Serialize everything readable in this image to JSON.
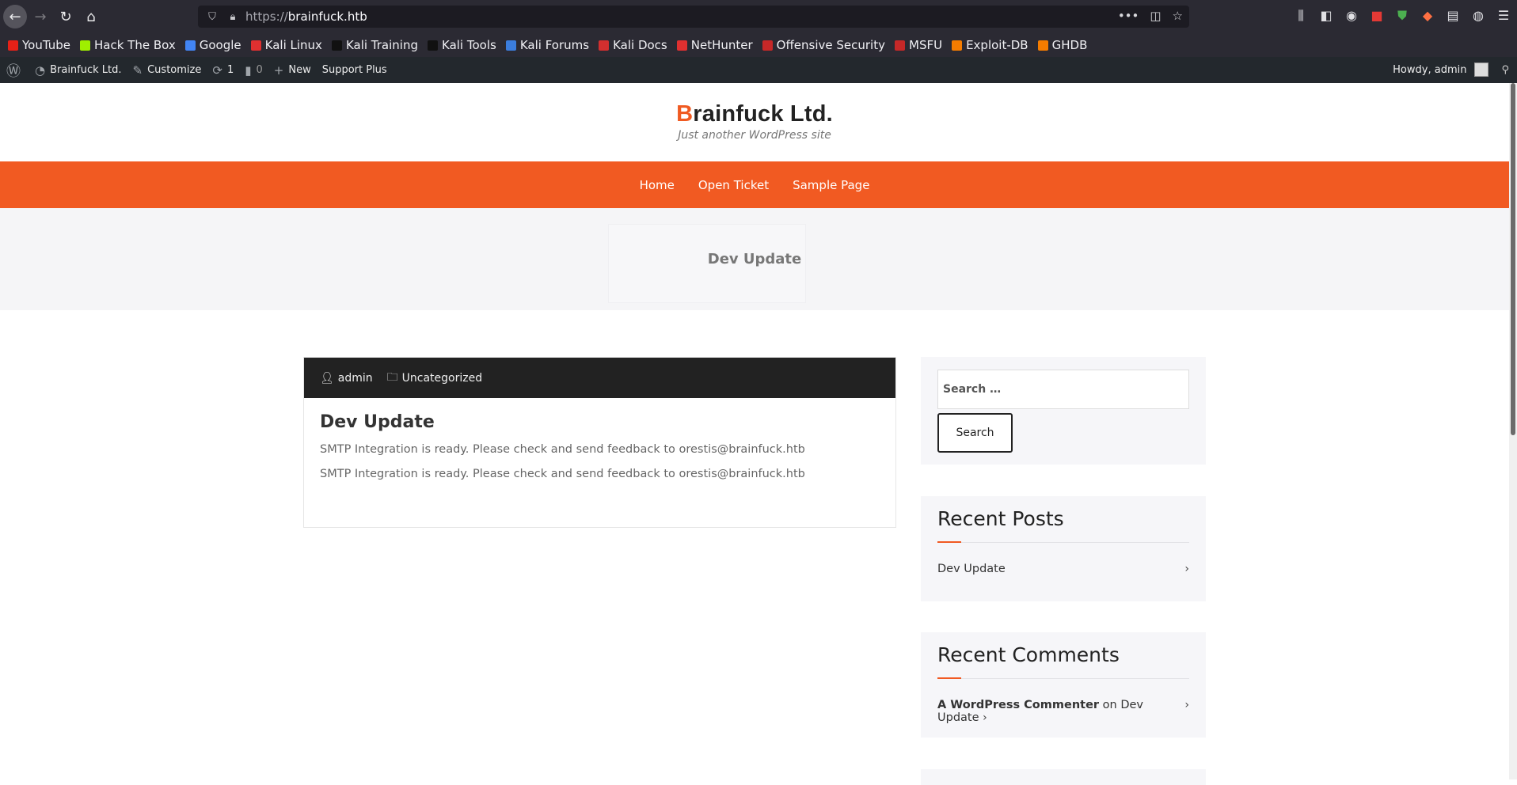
{
  "browser": {
    "url_proto": "https://",
    "url_host": "brainfuck.htb",
    "bookmarks": [
      {
        "label": "YouTube",
        "color": "#e62117"
      },
      {
        "label": "Hack The Box",
        "color": "#9fef00"
      },
      {
        "label": "Google",
        "color": "#4285f4"
      },
      {
        "label": "Kali Linux",
        "color": "#e03030"
      },
      {
        "label": "Kali Training",
        "color": "#111111"
      },
      {
        "label": "Kali Tools",
        "color": "#111111"
      },
      {
        "label": "Kali Forums",
        "color": "#3b7ddd"
      },
      {
        "label": "Kali Docs",
        "color": "#d32f2f"
      },
      {
        "label": "NetHunter",
        "color": "#e03030"
      },
      {
        "label": "Offensive Security",
        "color": "#c62828"
      },
      {
        "label": "MSFU",
        "color": "#c62828"
      },
      {
        "label": "Exploit-DB",
        "color": "#f57c00"
      },
      {
        "label": "GHDB",
        "color": "#f57c00"
      }
    ]
  },
  "adminbar": {
    "site": "Brainfuck Ltd.",
    "customize": "Customize",
    "updates": "1",
    "comments": "0",
    "new": "New",
    "support": "Support Plus",
    "howdy": "Howdy, admin"
  },
  "header": {
    "title_first": "B",
    "title_rest": "rainfuck Ltd.",
    "tagline": "Just another WordPress site"
  },
  "menu": [
    "Home",
    "Open Ticket",
    "Sample Page"
  ],
  "banner": {
    "title": "Dev Update"
  },
  "post": {
    "author": "admin",
    "category": "Uncategorized",
    "title": "Dev Update",
    "paragraphs": [
      "SMTP Integration is ready. Please check and send feedback to orestis@brainfuck.htb",
      "SMTP Integration is ready. Please check and send feedback to orestis@brainfuck.htb"
    ]
  },
  "sidebar": {
    "search_placeholder": "Search …",
    "search_button": "Search",
    "recent_posts_title": "Recent Posts",
    "recent_post": "Dev Update",
    "recent_comments_title": "Recent Comments",
    "comment_author": "A WordPress Commenter",
    "comment_on": "on",
    "comment_post": "Dev Update"
  },
  "colors": {
    "accent": "#f15a22",
    "adminbar": "#23282d",
    "browser": "#2b2a33"
  }
}
